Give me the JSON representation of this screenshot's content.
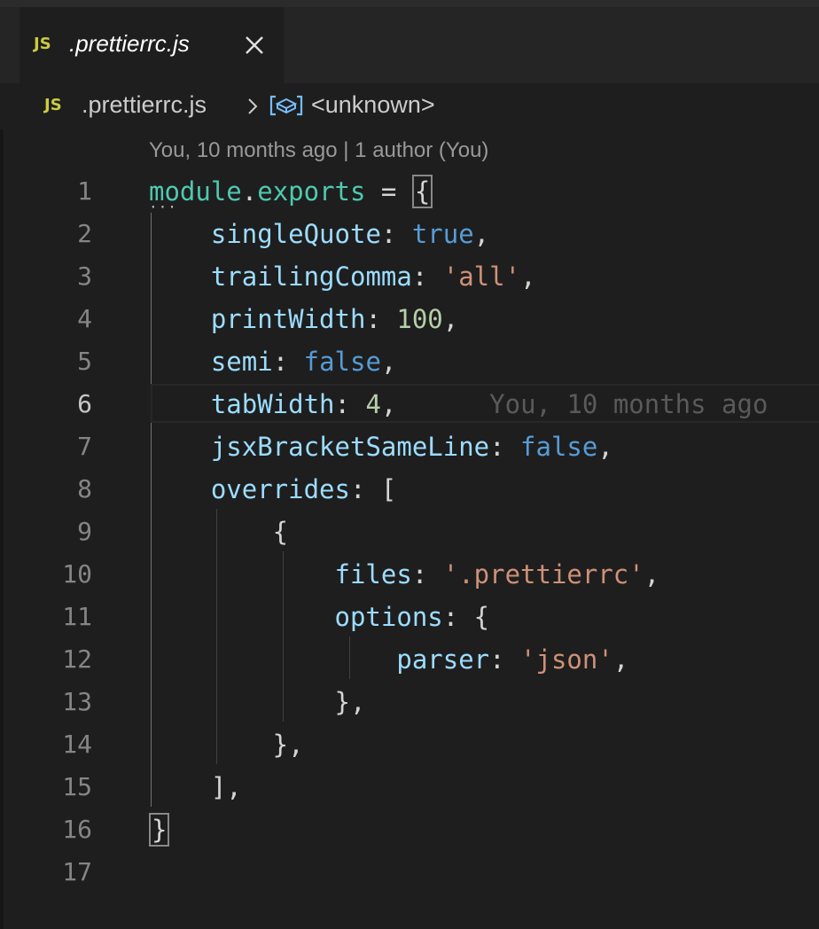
{
  "tab": {
    "badge": "JS",
    "title": ".prettierrc.js"
  },
  "breadcrumb": {
    "badge": "JS",
    "file": ".prettierrc.js",
    "symbol": "<unknown>"
  },
  "codelens": {
    "text": "You, 10 months ago | 1 author (You)"
  },
  "blame": {
    "text": "You, 10 months ago"
  },
  "lines": [
    {
      "number": "1",
      "tokens": [
        [
          "kw",
          "module"
        ],
        [
          "punc",
          "."
        ],
        [
          "kw",
          "exports"
        ],
        [
          "punc",
          " = "
        ],
        [
          "match",
          "{"
        ]
      ]
    },
    {
      "number": "2",
      "tokens": [
        [
          "punc",
          "    "
        ],
        [
          "prop",
          "singleQuote"
        ],
        [
          "punc",
          ": "
        ],
        [
          "bool",
          "true"
        ],
        [
          "punc",
          ","
        ]
      ]
    },
    {
      "number": "3",
      "tokens": [
        [
          "punc",
          "    "
        ],
        [
          "prop",
          "trailingComma"
        ],
        [
          "punc",
          ": "
        ],
        [
          "str",
          "'all'"
        ],
        [
          "punc",
          ","
        ]
      ]
    },
    {
      "number": "4",
      "tokens": [
        [
          "punc",
          "    "
        ],
        [
          "prop",
          "printWidth"
        ],
        [
          "punc",
          ": "
        ],
        [
          "num",
          "100"
        ],
        [
          "punc",
          ","
        ]
      ]
    },
    {
      "number": "5",
      "tokens": [
        [
          "punc",
          "    "
        ],
        [
          "prop",
          "semi"
        ],
        [
          "punc",
          ": "
        ],
        [
          "bool",
          "false"
        ],
        [
          "punc",
          ","
        ]
      ]
    },
    {
      "number": "6",
      "tokens": [
        [
          "punc",
          "    "
        ],
        [
          "prop",
          "tabWidth"
        ],
        [
          "punc",
          ": "
        ],
        [
          "num",
          "4"
        ],
        [
          "punc",
          ","
        ],
        [
          "punc",
          "      "
        ],
        [
          "blame",
          "You, 10 months ago"
        ]
      ]
    },
    {
      "number": "7",
      "tokens": [
        [
          "punc",
          "    "
        ],
        [
          "prop",
          "jsxBracketSameLine"
        ],
        [
          "punc",
          ": "
        ],
        [
          "bool",
          "false"
        ],
        [
          "punc",
          ","
        ]
      ]
    },
    {
      "number": "8",
      "tokens": [
        [
          "punc",
          "    "
        ],
        [
          "prop",
          "overrides"
        ],
        [
          "punc",
          ": ["
        ]
      ]
    },
    {
      "number": "9",
      "tokens": [
        [
          "punc",
          "        {"
        ]
      ]
    },
    {
      "number": "10",
      "tokens": [
        [
          "punc",
          "            "
        ],
        [
          "prop",
          "files"
        ],
        [
          "punc",
          ": "
        ],
        [
          "str",
          "'.prettierrc'"
        ],
        [
          "punc",
          ","
        ]
      ]
    },
    {
      "number": "11",
      "tokens": [
        [
          "punc",
          "            "
        ],
        [
          "prop",
          "options"
        ],
        [
          "punc",
          ": {"
        ]
      ]
    },
    {
      "number": "12",
      "tokens": [
        [
          "punc",
          "                "
        ],
        [
          "prop",
          "parser"
        ],
        [
          "punc",
          ": "
        ],
        [
          "str",
          "'json'"
        ],
        [
          "punc",
          ","
        ]
      ]
    },
    {
      "number": "13",
      "tokens": [
        [
          "punc",
          "            },"
        ]
      ]
    },
    {
      "number": "14",
      "tokens": [
        [
          "punc",
          "        },"
        ]
      ]
    },
    {
      "number": "15",
      "tokens": [
        [
          "punc",
          "    ],"
        ]
      ]
    },
    {
      "number": "16",
      "tokens": [
        [
          "match",
          "}"
        ]
      ]
    },
    {
      "number": "17",
      "tokens": []
    }
  ],
  "active_line": "6",
  "colors": {
    "background": "#1e1e1e",
    "keyword": "#4ec9b0",
    "property": "#9cdcfe",
    "boolean": "#569cd6",
    "number": "#b5cea8",
    "string": "#ce9178",
    "js_badge": "#cbcb41"
  }
}
